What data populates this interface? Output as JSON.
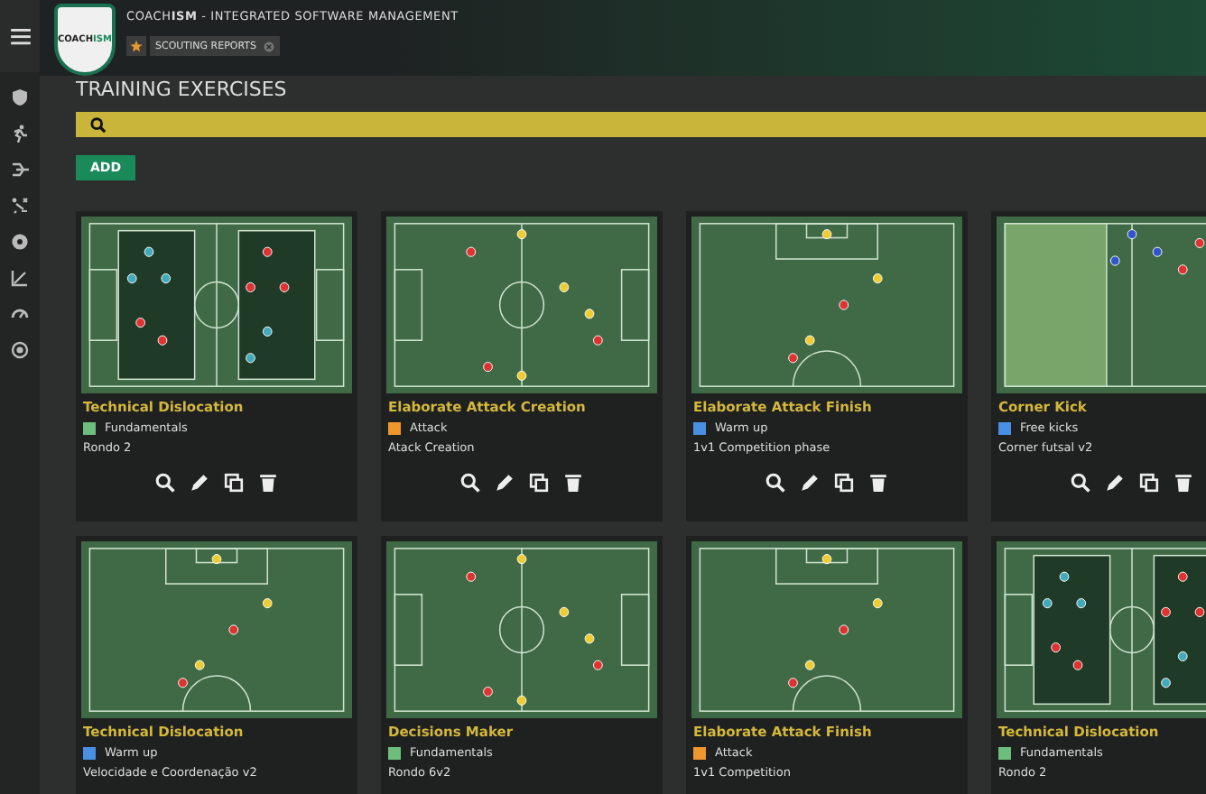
{
  "app_title": "COACH**ISM** - INTEGRATED SOFTWARE MANAGEMENT",
  "logo": {
    "text": "COACH",
    "highlight": "ISM"
  },
  "breadcrumb": {
    "favorite": true,
    "label": "SCOUTING REPORTS"
  },
  "page_title": "TRAINING EXERCISES",
  "add_button": "ADD",
  "sidebar": {
    "items": [
      {
        "kind": "shield"
      },
      {
        "kind": "runner"
      },
      {
        "kind": "tactic"
      },
      {
        "kind": "drills"
      },
      {
        "kind": "ball"
      },
      {
        "kind": "chart"
      },
      {
        "kind": "gauge"
      },
      {
        "kind": "target"
      }
    ]
  },
  "exercises": [
    {
      "title": "Technical Dislocation",
      "category": "Fundamentals",
      "color": "#6dbd7c",
      "subtitle": "Rondo 2"
    },
    {
      "title": "Elaborate Attack Creation",
      "category": "Attack",
      "color": "#f0962e",
      "subtitle": "Atack Creation"
    },
    {
      "title": "Elaborate Attack Finish",
      "category": "Warm up",
      "color": "#4a90e2",
      "subtitle": "1v1 Competition phase"
    },
    {
      "title": "Corner Kick",
      "category": "Free kicks",
      "color": "#4a90e2",
      "subtitle": "Corner futsal v2"
    },
    {
      "title": "Technical Dislocation",
      "category": "Warm up",
      "color": "#4a90e2",
      "subtitle": "Velocidade e Coordenação v2"
    },
    {
      "title": "Decisions Maker",
      "category": "Fundamentals",
      "color": "#6dbd7c",
      "subtitle": "Rondo 6v2"
    },
    {
      "title": "Elaborate Attack Finish",
      "category": "Attack",
      "color": "#f0962e",
      "subtitle": "1v1 Competition"
    },
    {
      "title": "Technical Dislocation",
      "category": "Fundamentals",
      "color": "#6dbd7c",
      "subtitle": "Rondo 2"
    }
  ]
}
